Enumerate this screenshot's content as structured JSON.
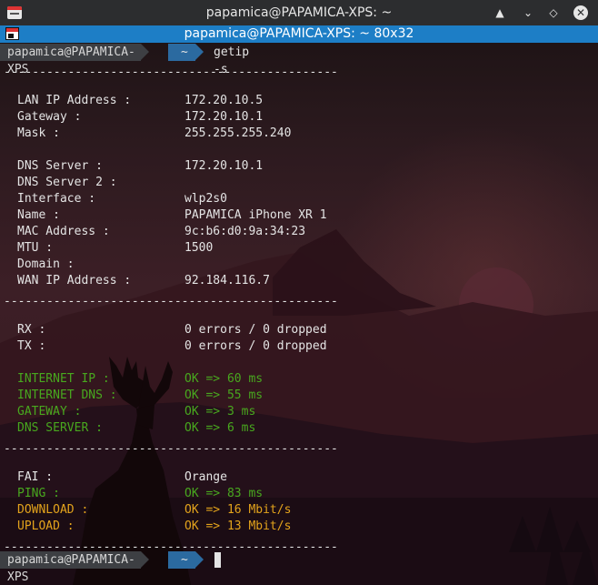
{
  "window": {
    "title": "papamica@PAPAMICA-XPS: ~",
    "tab_title": "papamica@PAPAMICA-XPS: ~ 80x32",
    "icons": [
      "terminal-app-icon",
      "shade-icon",
      "minimize-icon",
      "maximize-icon",
      "close-icon"
    ],
    "glyphs": {
      "shade": "▲",
      "minimize": "⌄",
      "maximize": "◇",
      "close": "✕"
    }
  },
  "prompt": {
    "host": "papamica@PAPAMICA-XPS",
    "dir": "~",
    "command": "getip -s"
  },
  "separator": "-----------------------------------------------",
  "network": [
    {
      "label": "LAN IP Address :",
      "value": "172.20.10.5"
    },
    {
      "label": "Gateway :",
      "value": "172.20.10.1"
    },
    {
      "label": "Mask :",
      "value": "255.255.255.240"
    }
  ],
  "details": [
    {
      "label": "DNS Server :",
      "value": "172.20.10.1"
    },
    {
      "label": "DNS Server 2 :",
      "value": ""
    },
    {
      "label": "Interface :",
      "value": "wlp2s0"
    },
    {
      "label": "Name :",
      "value": "PAPAMICA iPhone XR 1"
    },
    {
      "label": "MAC Address :",
      "value": "9c:b6:d0:9a:34:23"
    },
    {
      "label": "MTU :",
      "value": "1500"
    },
    {
      "label": "Domain :",
      "value": ""
    },
    {
      "label": "WAN IP Address :",
      "value": "92.184.116.7"
    }
  ],
  "traffic": [
    {
      "label": "RX :",
      "value": "0 errors / 0 dropped"
    },
    {
      "label": "TX :",
      "value": "0 errors / 0 dropped"
    }
  ],
  "checks": [
    {
      "label": "INTERNET IP :",
      "value": "OK => 60 ms"
    },
    {
      "label": "INTERNET DNS :",
      "value": "OK => 55 ms"
    },
    {
      "label": "GATEWAY :",
      "value": "OK => 3 ms"
    },
    {
      "label": "DNS SERVER :",
      "value": "OK => 6 ms"
    }
  ],
  "isp": {
    "fai_label": "FAI :",
    "fai_value": "Orange",
    "ping_label": "PING :",
    "ping_value": "OK => 83 ms",
    "download_label": "DOWNLOAD :",
    "download_value": "OK => 16 Mbit/s",
    "upload_label": "UPLOAD :",
    "upload_value": "OK => 13 Mbit/s"
  },
  "colors": {
    "ok_green": "#48a81e",
    "speed_yellow": "#e3a31c",
    "tab_blue": "#1d7ec6",
    "text": "#e4e4e4"
  }
}
